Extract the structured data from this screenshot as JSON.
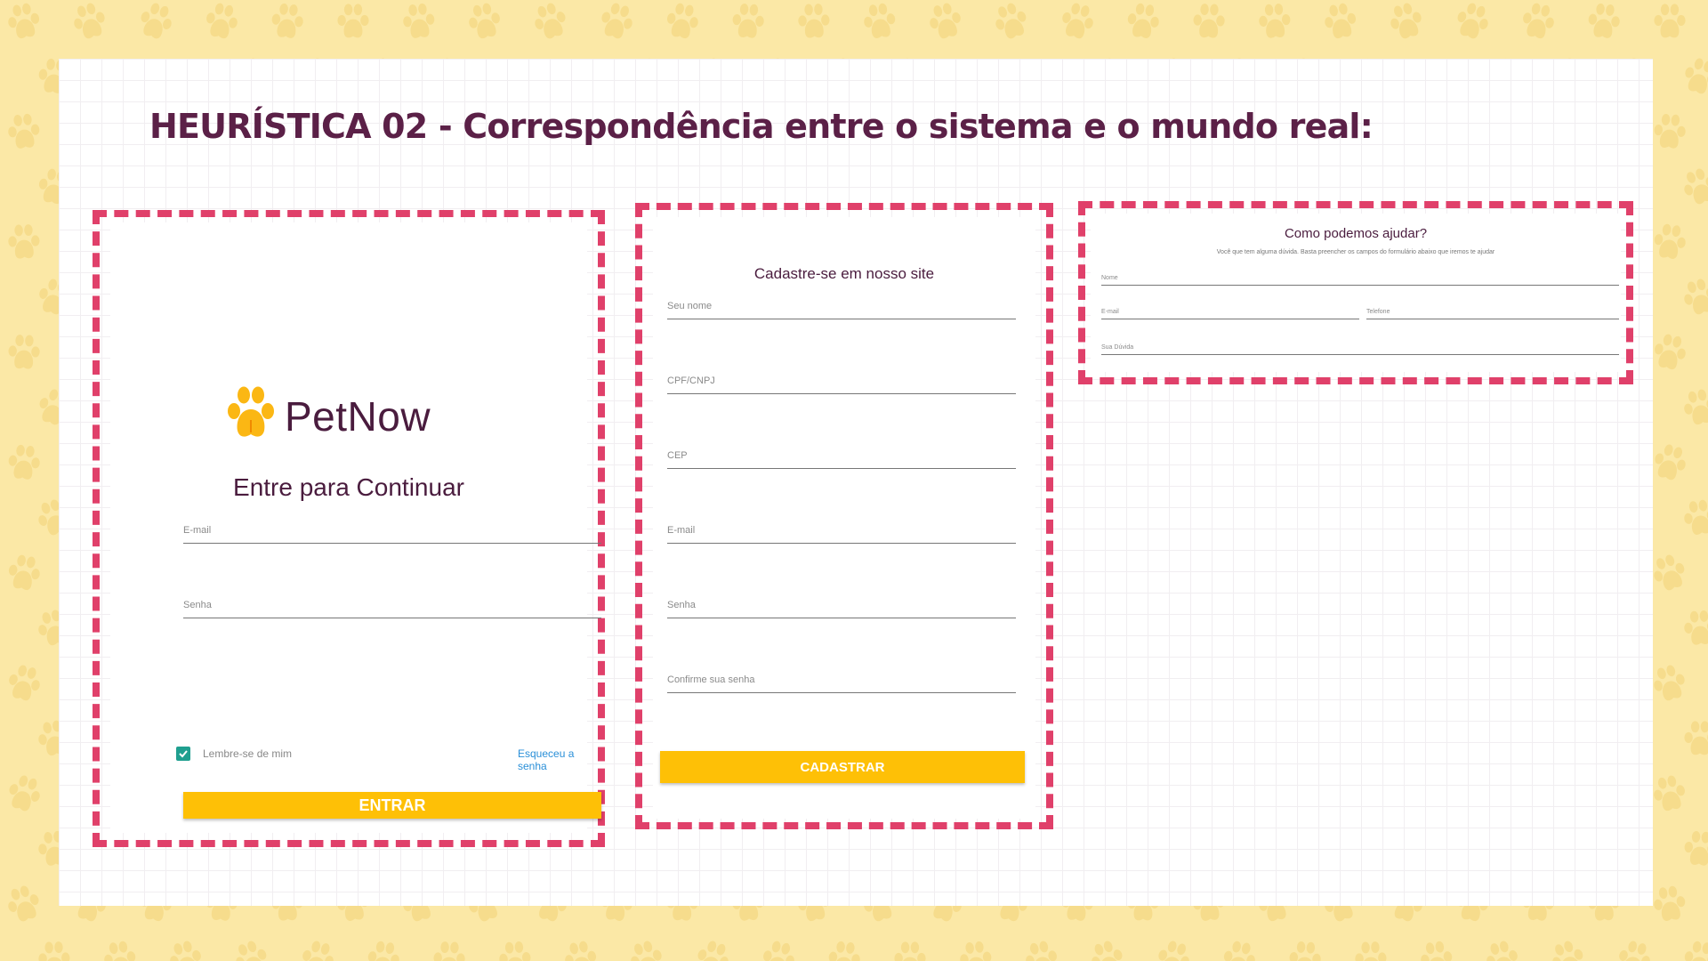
{
  "slide": {
    "heading": "HEURÍSTICA 02 - Correspondência entre o sistema e o mundo real:"
  },
  "colors": {
    "background": "#fbe8a6",
    "heading": "#5b2047",
    "dashed_border": "#e0406a",
    "button": "#fec006",
    "checkbox": "#1f9f8f",
    "link": "#2a8fd8"
  },
  "login": {
    "logo_icon": "paw-icon",
    "brand": "PetNow",
    "title": "Entre para Continuar",
    "email_label": "E-mail",
    "password_label": "Senha",
    "remember_label": "Lembre-se de mim",
    "remember_checked": true,
    "forgot_link": "Esqueceu a senha",
    "submit": "ENTRAR"
  },
  "signup": {
    "title": "Cadastre-se em nosso site",
    "fields": [
      "Seu nome",
      "CPF/CNPJ",
      "CEP",
      "E-mail",
      "Senha",
      "Confirme sua senha"
    ],
    "submit": "CADASTRAR"
  },
  "contact": {
    "title": "Como podemos ajudar?",
    "subtitle": "Você que tem alguma dúvida. Basta preencher os campos do formulário abaixo que iremos te ajudar",
    "name_label": "Nome",
    "email_label": "E-mail",
    "phone_label": "Telefone",
    "question_label": "Sua Dúvida"
  }
}
